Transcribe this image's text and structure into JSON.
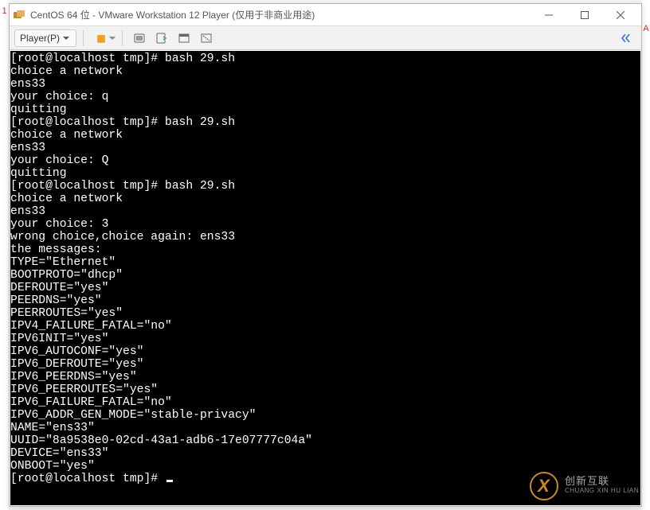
{
  "left_edge_label": "1",
  "right_edge_label": "A",
  "titlebar": {
    "title": "CentOS 64 位 - VMware Workstation 12 Player (仅用于非商业用途)"
  },
  "toolbar": {
    "player_label": "Player(P)",
    "icons": {
      "pause": "pause-icon",
      "send_ctrl_alt_del": "send-cad-icon",
      "install_tools": "tools-icon",
      "fullscreen": "fullscreen-icon",
      "unity": "unity-icon"
    }
  },
  "terminal_lines": [
    "[root@localhost tmp]# bash 29.sh",
    "choice a network",
    "ens33",
    "your choice: q",
    "quitting",
    "[root@localhost tmp]# bash 29.sh",
    "choice a network",
    "ens33",
    "your choice: Q",
    "quitting",
    "[root@localhost tmp]# bash 29.sh",
    "choice a network",
    "ens33",
    "your choice: 3",
    "wrong choice,choice again: ens33",
    "the messages:",
    "TYPE=\"Ethernet\"",
    "BOOTPROTO=\"dhcp\"",
    "DEFROUTE=\"yes\"",
    "PEERDNS=\"yes\"",
    "PEERROUTES=\"yes\"",
    "IPV4_FAILURE_FATAL=\"no\"",
    "IPV6INIT=\"yes\"",
    "IPV6_AUTOCONF=\"yes\"",
    "IPV6_DEFROUTE=\"yes\"",
    "IPV6_PEERDNS=\"yes\"",
    "IPV6_PEERROUTES=\"yes\"",
    "IPV6_FAILURE_FATAL=\"no\"",
    "IPV6_ADDR_GEN_MODE=\"stable-privacy\"",
    "NAME=\"ens33\"",
    "UUID=\"8a9538e0-02cd-43a1-adb6-17e07777c04a\"",
    "DEVICE=\"ens33\"",
    "ONBOOT=\"yes\""
  ],
  "prompt_line": "[root@localhost tmp]# ",
  "watermark": {
    "cn": "创新互联",
    "en": "CHUANG XIN HU LIAN"
  }
}
